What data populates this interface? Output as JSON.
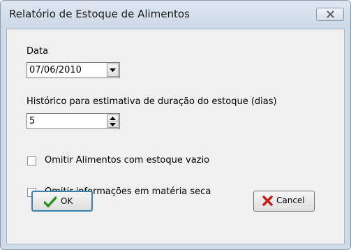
{
  "window": {
    "title": "Relatório de Estoque de Alimentos",
    "close_icon": "close-x-icon"
  },
  "form": {
    "date_label": "Data",
    "date_value": "07/06/2010",
    "history_label": "Histórico para estimativa de duração do estoque (dias)",
    "history_value": "5",
    "omit_empty_label": "Omitir Alimentos com estoque vazio",
    "omit_empty_checked": false,
    "omit_dry_matter_label": "Omitir informações em matéria seca",
    "omit_dry_matter_checked": false
  },
  "buttons": {
    "ok_label": "OK",
    "ok_icon": "green-checkmark-icon",
    "cancel_label": "Cancel",
    "cancel_icon": "red-x-icon"
  },
  "colors": {
    "titlebar": "#cfdbe8",
    "client_bg": "#f0f0f0",
    "ok_accent": "#3c7fb1",
    "check_green": "#2f8f1f",
    "cancel_red": "#c0201a"
  }
}
